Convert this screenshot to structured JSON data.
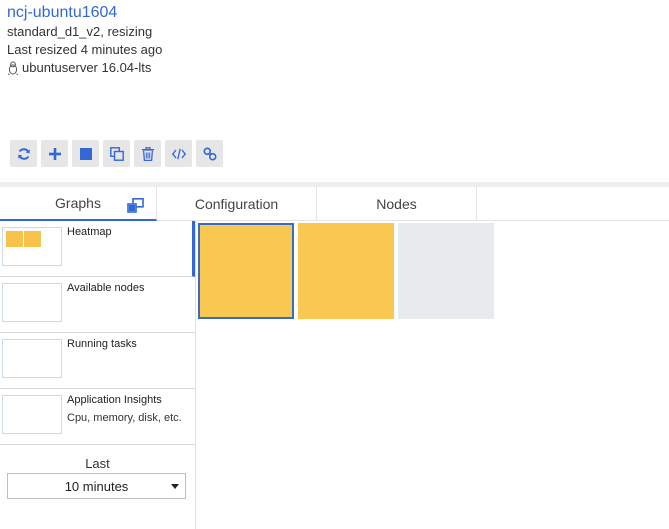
{
  "header": {
    "title": "ncj-ubuntu1604",
    "vm_state": "standard_d1_v2, resizing",
    "last_resized": "Last resized 4 minutes ago",
    "os": "ubuntuserver 16.04-lts"
  },
  "toolbar": {
    "buttons": [
      {
        "name": "refresh",
        "icon": "refresh-icon"
      },
      {
        "name": "add",
        "icon": "plus-icon"
      },
      {
        "name": "stop",
        "icon": "stop-icon"
      },
      {
        "name": "clone",
        "icon": "clone-icon"
      },
      {
        "name": "delete",
        "icon": "trash-icon"
      },
      {
        "name": "code",
        "icon": "code-icon"
      },
      {
        "name": "link",
        "icon": "link-icon"
      }
    ]
  },
  "tabs": [
    {
      "label": "Graphs",
      "active": true
    },
    {
      "label": "Configuration",
      "active": false
    },
    {
      "label": "Nodes",
      "active": false
    }
  ],
  "graphs": [
    {
      "label": "Heatmap",
      "sub": "",
      "active": true
    },
    {
      "label": "Available nodes",
      "sub": ""
    },
    {
      "label": "Running tasks",
      "sub": ""
    },
    {
      "label": "Application Insights",
      "sub": "Cpu, memory, disk, etc."
    }
  ],
  "time_range": {
    "label": "Last",
    "selected": "10 minutes"
  },
  "heatmap": {
    "nodes": [
      {
        "state": "running",
        "color": "#f9c851",
        "selected": true
      },
      {
        "state": "running",
        "color": "#f9c851",
        "selected": false
      },
      {
        "state": "unavailable",
        "color": "#e9eaed",
        "selected": false
      }
    ]
  },
  "colors": {
    "accent": "#3367d6",
    "toolbar_bg": "#e6e6e6"
  }
}
